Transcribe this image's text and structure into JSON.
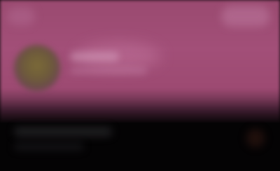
{
  "screen": {
    "banner_color": "#9d4a72",
    "background_color": "#050405"
  },
  "header": {
    "back_icon": "back-icon",
    "actions_icon": "actions-icon"
  },
  "profile": {
    "avatar_icon": "avatar-icon"
  }
}
